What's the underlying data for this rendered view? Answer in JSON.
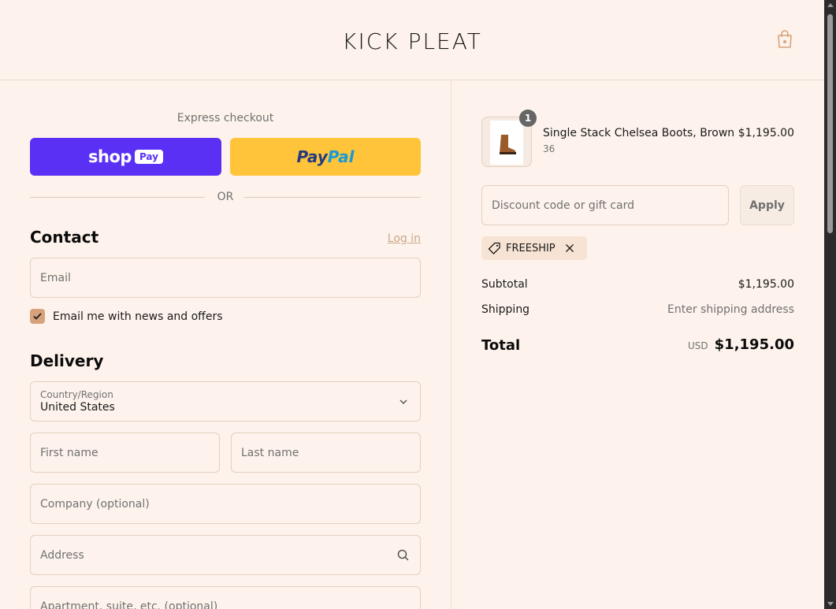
{
  "header": {
    "brand": "KICK PLEAT",
    "cart_icon": "shopping-bag-icon"
  },
  "express": {
    "label": "Express checkout",
    "shop_pay": {
      "word": "shop",
      "chip": "Pay",
      "color": "#5a31f4"
    },
    "paypal": {
      "part1": "Pay",
      "part2": "Pal",
      "color": "#ffc439"
    },
    "or_label": "OR"
  },
  "contact": {
    "title": "Contact",
    "login_link": "Log in",
    "email_placeholder": "Email",
    "newsletter_label": "Email me with news and offers",
    "newsletter_checked": true
  },
  "delivery": {
    "title": "Delivery",
    "country_label": "Country/Region",
    "country_value": "United States",
    "first_name_placeholder": "First name",
    "last_name_placeholder": "Last name",
    "company_placeholder": "Company (optional)",
    "address_placeholder": "Address",
    "apartment_placeholder": "Apartment, suite, etc. (optional)"
  },
  "summary": {
    "item": {
      "quantity": "1",
      "name": "Single Stack Chelsea Boots, Brown",
      "variant": "36",
      "price": "$1,195.00"
    },
    "discount_placeholder": "Discount code or gift card",
    "apply_label": "Apply",
    "applied_code": "FREESHIP",
    "subtotal_label": "Subtotal",
    "subtotal_value": "$1,195.00",
    "shipping_label": "Shipping",
    "shipping_value": "Enter shipping address",
    "total_label": "Total",
    "total_currency": "USD",
    "total_value": "$1,195.00"
  },
  "colors": {
    "background": "#fdf3ec",
    "accent": "#d7a27b",
    "link": "#c9a78a"
  }
}
